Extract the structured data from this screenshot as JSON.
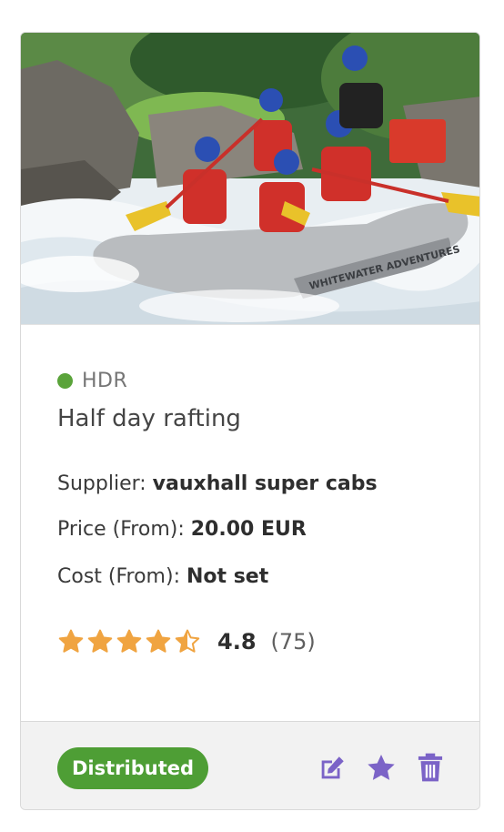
{
  "colors": {
    "status_dot": "#5aa33a",
    "star": "#f0a441",
    "badge": "#4e9e35",
    "action_icon": "#7b63c7"
  },
  "product": {
    "image": "photo of a whitewater rafting group paddling through rapids",
    "raft_text": "WHITEWATER ADVENTURES",
    "code": "HDR",
    "title": "Half day rafting",
    "supplier_label": "Supplier:",
    "supplier_value": "vauxhall super cabs",
    "price_label": "Price (From):",
    "price_value": "20.00 EUR",
    "cost_label": "Cost (From):",
    "cost_value": "Not set"
  },
  "rating": {
    "score": "4.8",
    "count": "(75)",
    "stars_filled": 4.5,
    "stars_max": 5
  },
  "footer": {
    "status_badge": "Distributed",
    "actions": [
      {
        "name": "edit-icon"
      },
      {
        "name": "star-icon"
      },
      {
        "name": "trash-icon"
      }
    ]
  }
}
